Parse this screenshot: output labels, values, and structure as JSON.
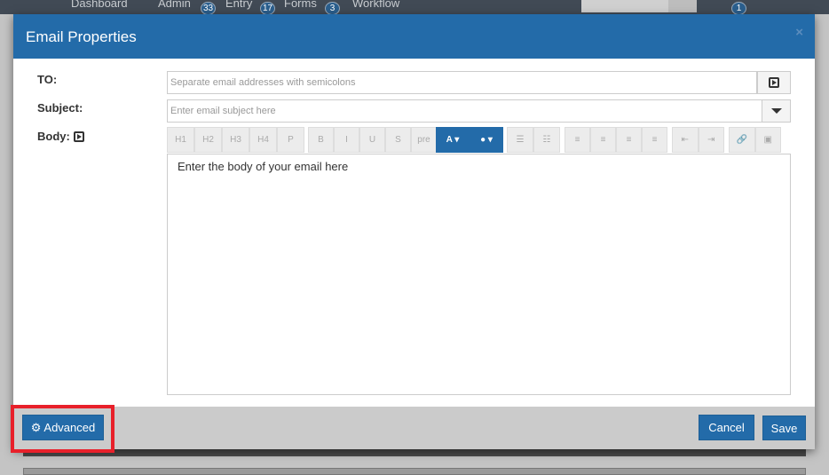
{
  "topbar": {
    "items": [
      {
        "label": "Dashboard"
      },
      {
        "label": "Admin"
      },
      {
        "label": "Entry",
        "badge": "33"
      },
      {
        "label": "Forms",
        "badge": "17"
      },
      {
        "label": "Workflow",
        "badge": "3"
      }
    ],
    "notifications_badge": "1"
  },
  "modal": {
    "title": "Email Properties",
    "close": "×",
    "to": {
      "label": "TO:",
      "placeholder": "Separate email addresses with semicolons"
    },
    "subject": {
      "label": "Subject:",
      "placeholder": "Enter email subject here"
    },
    "body": {
      "label": "Body:",
      "placeholder": "Enter the body of your email here"
    },
    "toolbar": {
      "headings": [
        "H1",
        "H2",
        "H3",
        "H4",
        "P"
      ],
      "format": [
        "B",
        "I",
        "U",
        "S",
        "pre"
      ],
      "font_color": "A ▾",
      "bg_color": "● ▾",
      "lists": [
        "☰",
        "☷"
      ],
      "align": [
        "≡",
        "≡",
        "≡",
        "≡"
      ],
      "indent": [
        "⇤",
        "⇥"
      ],
      "insert": [
        "🔗",
        "▣"
      ]
    },
    "footer": {
      "advanced": "Advanced",
      "cancel": "Cancel",
      "save": "Save"
    }
  },
  "colors": {
    "primary": "#236ba9",
    "highlight": "#e8202a"
  }
}
